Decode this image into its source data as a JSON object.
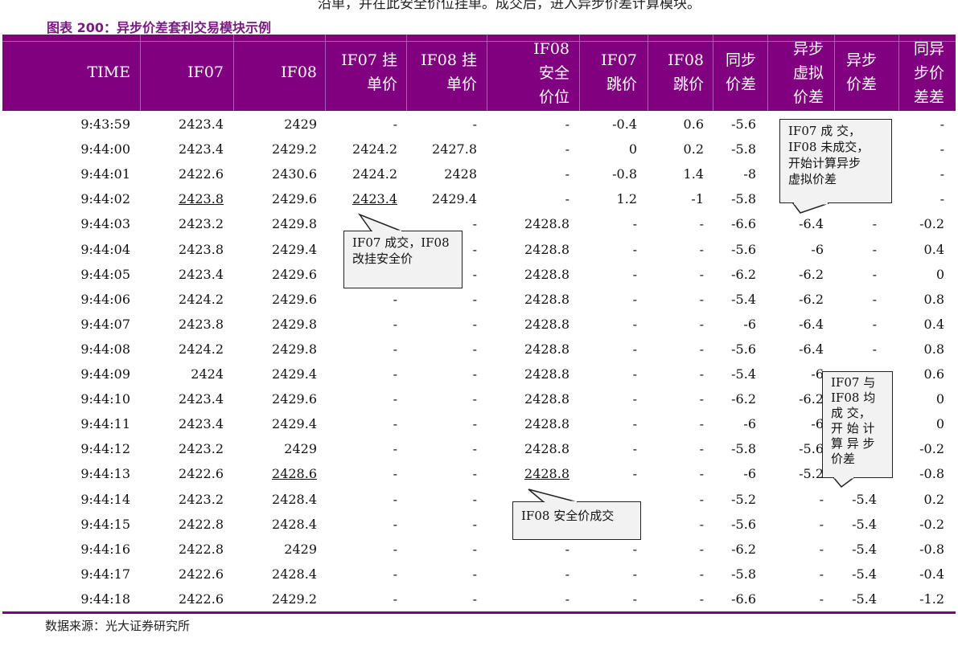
{
  "intro_text": "沿单，并在此安全价位挂单。成交后，进入异步价差计算模块。",
  "figure_title": "图表 200：异步价差套利交易模块示例",
  "columns": [
    [
      "TIME"
    ],
    [
      "IF07"
    ],
    [
      "IF08"
    ],
    [
      "IF07 挂",
      "单价"
    ],
    [
      "IF08 挂",
      "单价"
    ],
    [
      "IF08",
      "安全",
      "价位"
    ],
    [
      "IF07",
      "跳价"
    ],
    [
      "IF08",
      "跳价"
    ],
    [
      "同步",
      "价差"
    ],
    [
      "异步",
      "虚拟",
      "价差"
    ],
    [
      "异步",
      "价差"
    ],
    [
      "同异",
      "步价",
      "差差"
    ]
  ],
  "rows": [
    [
      "9:43:59",
      "2423.4",
      "2429",
      "-",
      "-",
      "-",
      "-0.4",
      "0.6",
      "-5.6",
      "",
      "",
      "-"
    ],
    [
      "9:44:00",
      "2423.4",
      "2429.2",
      "2424.2",
      "2427.8",
      "-",
      "0",
      "0.2",
      "-5.8",
      "",
      "",
      "-"
    ],
    [
      "9:44:01",
      "2422.6",
      "2430.6",
      "2424.2",
      "2428",
      "-",
      "-0.8",
      "1.4",
      "-8",
      "",
      "",
      "-"
    ],
    [
      "9:44:02",
      "2423.8",
      "2429.6",
      "2423.4",
      "2429.4",
      "-",
      "1.2",
      "-1",
      "-5.8",
      "",
      "",
      "-"
    ],
    [
      "9:44:03",
      "2423.2",
      "2429.8",
      "",
      "-",
      "2428.8",
      "-",
      "-",
      "-6.6",
      "-6.4",
      "-",
      "-0.2"
    ],
    [
      "9:44:04",
      "2423.8",
      "2429.4",
      "",
      "-",
      "2428.8",
      "-",
      "-",
      "-5.6",
      "-6",
      "-",
      "0.4"
    ],
    [
      "9:44:05",
      "2423.4",
      "2429.6",
      "",
      "-",
      "2428.8",
      "-",
      "-",
      "-6.2",
      "-6.2",
      "-",
      "0"
    ],
    [
      "9:44:06",
      "2424.2",
      "2429.6",
      "-",
      "-",
      "2428.8",
      "-",
      "-",
      "-5.4",
      "-6.2",
      "-",
      "0.8"
    ],
    [
      "9:44:07",
      "2423.8",
      "2429.8",
      "-",
      "-",
      "2428.8",
      "-",
      "-",
      "-6",
      "-6.4",
      "-",
      "0.4"
    ],
    [
      "9:44:08",
      "2424.2",
      "2429.8",
      "-",
      "-",
      "2428.8",
      "-",
      "-",
      "-5.6",
      "-6.4",
      "-",
      "0.8"
    ],
    [
      "9:44:09",
      "2424",
      "2429.4",
      "-",
      "-",
      "2428.8",
      "-",
      "-",
      "-5.4",
      "-6",
      "",
      "0.6"
    ],
    [
      "9:44:10",
      "2423.4",
      "2429.6",
      "-",
      "-",
      "2428.8",
      "-",
      "-",
      "-6.2",
      "-6.2",
      "",
      "0"
    ],
    [
      "9:44:11",
      "2423.4",
      "2429.4",
      "-",
      "-",
      "2428.8",
      "-",
      "-",
      "-6",
      "-6",
      "",
      "0"
    ],
    [
      "9:44:12",
      "2423.2",
      "2429",
      "-",
      "-",
      "2428.8",
      "-",
      "-",
      "-5.8",
      "-5.6",
      "",
      "-0.2"
    ],
    [
      "9:44:13",
      "2422.6",
      "2428.6",
      "-",
      "-",
      "2428.8",
      "-",
      "-",
      "-6",
      "-5.2",
      "",
      "-0.8"
    ],
    [
      "9:44:14",
      "2423.2",
      "2428.4",
      "-",
      "-",
      "",
      "",
      "-",
      "-5.2",
      "-",
      "-5.4",
      "0.2"
    ],
    [
      "9:44:15",
      "2422.8",
      "2428.4",
      "-",
      "-",
      "",
      "",
      "-",
      "-5.6",
      "-",
      "-5.4",
      "-0.2"
    ],
    [
      "9:44:16",
      "2422.8",
      "2429",
      "-",
      "-",
      "-",
      "-",
      "-",
      "-6.2",
      "-",
      "-5.4",
      "-0.8"
    ],
    [
      "9:44:17",
      "2422.6",
      "2428.4",
      "-",
      "-",
      "-",
      "-",
      "-",
      "-5.8",
      "-",
      "-5.4",
      "-0.4"
    ],
    [
      "9:44:18",
      "2422.6",
      "2429.2",
      "-",
      "-",
      "-",
      "-",
      "-",
      "-6.6",
      "-",
      "-5.4",
      "-1.2"
    ]
  ],
  "underlined_cells": [
    [
      3,
      1
    ],
    [
      3,
      3
    ],
    [
      14,
      2
    ],
    [
      14,
      5
    ]
  ],
  "callouts": [
    {
      "lines": [
        "IF07 成交，IF08",
        "改挂安全价"
      ]
    },
    {
      "lines": [
        "IF08 安全价成交"
      ]
    },
    {
      "lines": [
        "IF07  成 交，",
        "IF08 未成交，",
        "开始计算异步",
        "虚拟价差"
      ]
    },
    {
      "lines": [
        "IF07  与",
        "IF08  均",
        "成 交，",
        "开 始 计",
        "算 异 步",
        "价差"
      ]
    }
  ],
  "source": "数据来源：光大证券研究所",
  "colors": {
    "header_bg": "#800080",
    "title": "#7a1b82",
    "callout_bg": "#f2f2f2"
  }
}
